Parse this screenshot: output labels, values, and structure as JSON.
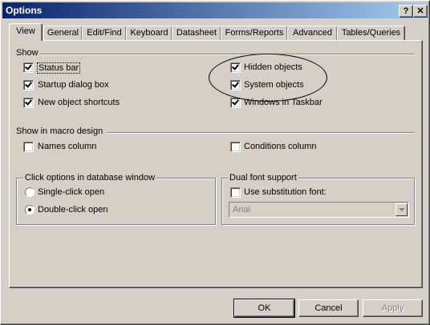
{
  "window": {
    "title": "Options",
    "help_btn": "?",
    "close_btn": "✕"
  },
  "tabs": [
    "View",
    "General",
    "Edit/Find",
    "Keyboard",
    "Datasheet",
    "Forms/Reports",
    "Advanced",
    "Tables/Queries"
  ],
  "show": {
    "label": "Show",
    "status_bar": "Status bar",
    "startup_dialog": "Startup dialog box",
    "new_object_shortcuts": "New object shortcuts",
    "hidden_objects": "Hidden objects",
    "system_objects": "System objects",
    "windows_in_taskbar": "Windows in Taskbar"
  },
  "macro": {
    "label": "Show in macro design",
    "names_column": "Names column",
    "conditions_column": "Conditions column"
  },
  "click_options": {
    "label": "Click options in database window",
    "single": "Single-click open",
    "double": "Double-click open"
  },
  "dual_font": {
    "label": "Dual font support",
    "use_substitution": "Use substitution font:",
    "font_value": "Arial"
  },
  "buttons": {
    "ok": "OK",
    "cancel": "Cancel",
    "apply": "Apply"
  }
}
